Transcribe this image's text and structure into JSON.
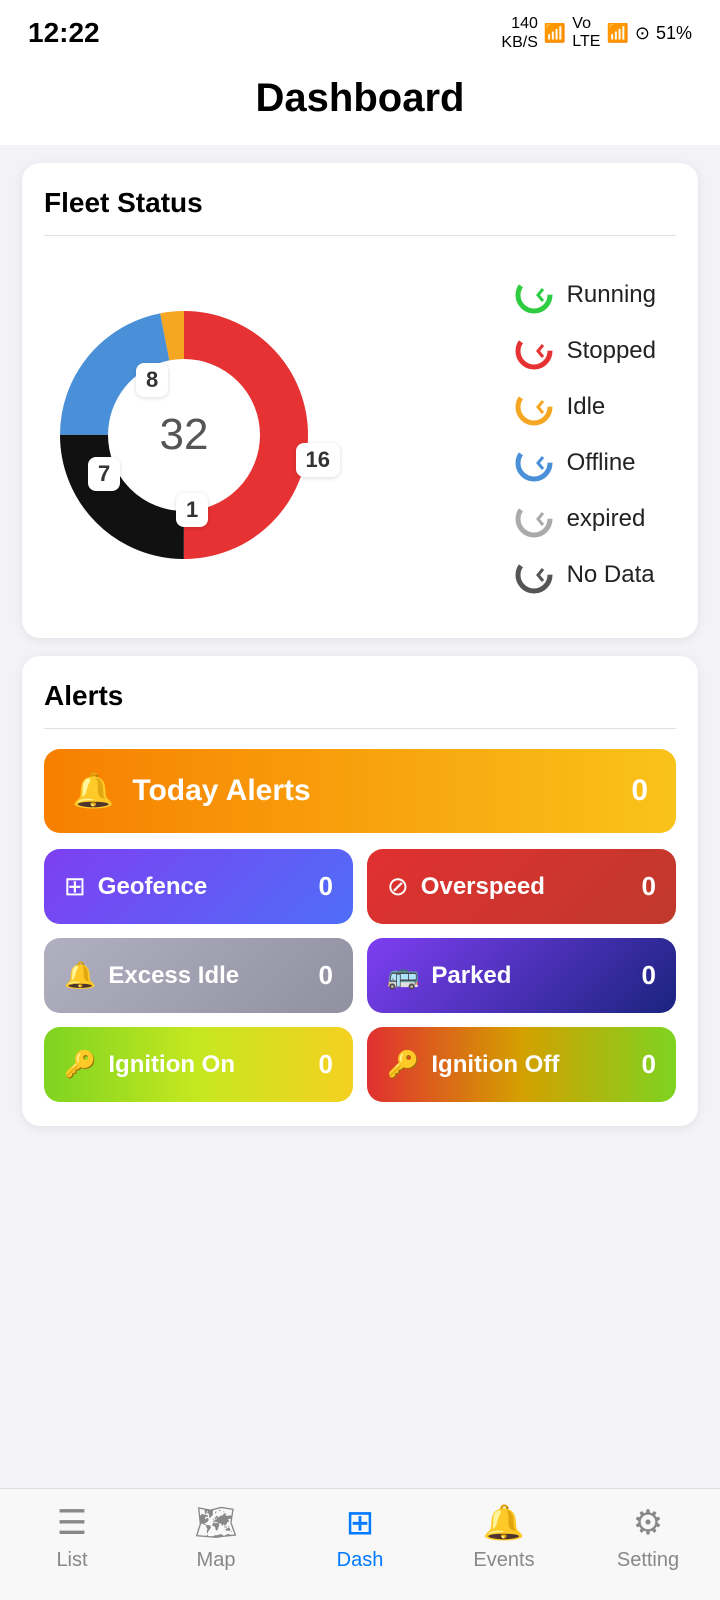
{
  "statusBar": {
    "time": "12:22",
    "battery": "51%",
    "signal": "140 KB/S"
  },
  "header": {
    "title": "Dashboard"
  },
  "fleetStatus": {
    "title": "Fleet Status",
    "total": "32",
    "segments": [
      {
        "label": "Running",
        "value": 16,
        "color": "#e63232"
      },
      {
        "label": "Stopped",
        "value": 8,
        "color": "#111111"
      },
      {
        "label": "Idle",
        "value": 1,
        "color": "#f5a623"
      },
      {
        "label": "Offline",
        "value": 7,
        "color": "#4a90d9"
      },
      {
        "label": "expired",
        "value": 0,
        "color": "#aaaaaa"
      },
      {
        "label": "No Data",
        "value": 0,
        "color": "#555555"
      }
    ],
    "labels": [
      {
        "text": "8",
        "class": "label-8"
      },
      {
        "text": "16",
        "class": "label-16"
      },
      {
        "text": "7",
        "class": "label-7"
      },
      {
        "text": "1",
        "class": "label-1"
      }
    ]
  },
  "alerts": {
    "title": "Alerts",
    "todayAlerts": {
      "label": "Today Alerts",
      "count": "0"
    },
    "buttons": [
      {
        "id": "geofence",
        "label": "Geofence",
        "count": "0",
        "icon": "⊞",
        "style": "btn-geofence"
      },
      {
        "id": "overspeed",
        "label": "Overspeed",
        "count": "0",
        "icon": "⊘",
        "style": "btn-overspeed"
      },
      {
        "id": "excess-idle",
        "label": "Excess Idle",
        "count": "0",
        "icon": "🔔",
        "style": "btn-excess"
      },
      {
        "id": "parked",
        "label": "Parked",
        "count": "0",
        "icon": "🚌",
        "style": "btn-parked"
      },
      {
        "id": "ignition-on",
        "label": "Ignition On",
        "count": "0",
        "icon": "🔑",
        "style": "btn-ignition-on"
      },
      {
        "id": "ignition-off",
        "label": "Ignition Off",
        "count": "0",
        "icon": "🔑",
        "style": "btn-ignition-off"
      }
    ]
  },
  "bottomNav": {
    "items": [
      {
        "id": "list",
        "label": "List",
        "icon": "☰",
        "active": false
      },
      {
        "id": "map",
        "label": "Map",
        "icon": "🗺",
        "active": false
      },
      {
        "id": "dash",
        "label": "Dash",
        "icon": "⊞",
        "active": true
      },
      {
        "id": "events",
        "label": "Events",
        "icon": "🔔",
        "active": false
      },
      {
        "id": "setting",
        "label": "Setting",
        "icon": "⚙",
        "active": false
      }
    ]
  }
}
